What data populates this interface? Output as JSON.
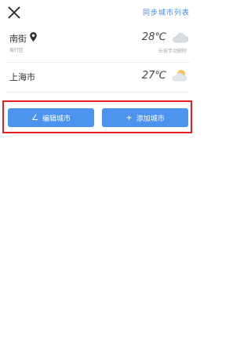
{
  "topbar": {
    "close_icon": "close-icon",
    "sync_label": "同步城市列表"
  },
  "cities": [
    {
      "name": "南街",
      "subtitle": "周行区",
      "has_location": true,
      "temperature": "28℃",
      "hint": "长按手动删除",
      "weather": "cloudy"
    },
    {
      "name": "上海市",
      "temperature": "27℃",
      "weather": "partly-cloudy"
    }
  ],
  "actions": {
    "edit_label": "编辑城市",
    "add_label": "添加城市",
    "edit_icon": "pencil-icon",
    "add_icon": "plus-icon"
  },
  "colors": {
    "accent": "#4c93ee",
    "link": "#3d8be0",
    "highlight_box": "#e02020"
  }
}
